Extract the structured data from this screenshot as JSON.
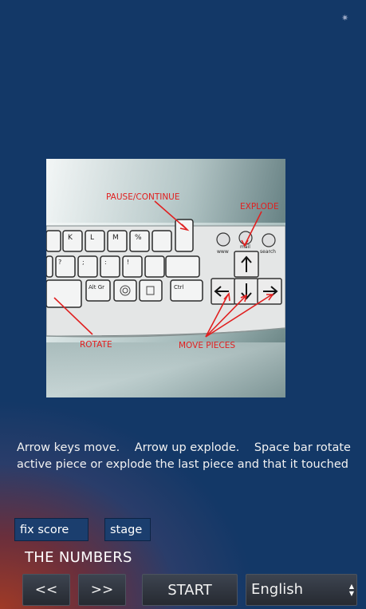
{
  "decor": {
    "star_glyph": "✷"
  },
  "instruction_image": {
    "labels": {
      "pause": "PAUSE/CONTINUE",
      "explode": "EXPLODE",
      "rotate": "ROTATE",
      "move": "MOVE PIECES"
    },
    "keys": {
      "k": "K",
      "l": "L",
      "m": "M",
      "percent": "%",
      "question": "?",
      "semicolon": ";",
      "colon": ":",
      "exclaim": "!",
      "altgr": "Alt Gr",
      "ctrl": "Ctrl",
      "www": "www",
      "mail": "mail",
      "search": "search"
    }
  },
  "instructions_text": "Arrow keys move.    Arrow up explode.    Space bar rotate active piece or explode the last piece and that it touched",
  "fields": {
    "fix_score": "fix score",
    "stage": "stage"
  },
  "game_title": "THE NUMBERS",
  "buttons": {
    "prev": "<<",
    "next": ">>",
    "start": "START"
  },
  "language": {
    "selected": "English"
  }
}
